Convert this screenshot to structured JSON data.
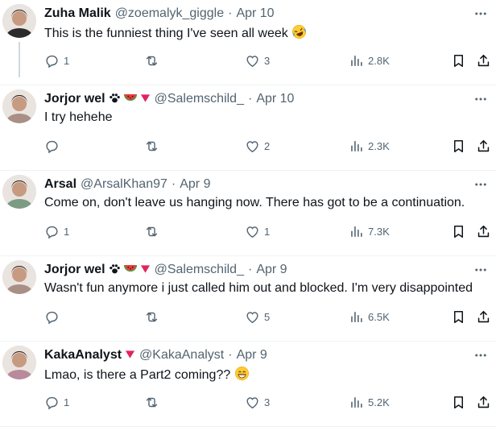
{
  "replies": [
    {
      "name": "Zuha Malik",
      "handle": "@zoemalyk_giggle",
      "dot": "·",
      "date": "Apr 10",
      "text": "This is the funniest thing I've seen all week",
      "emoji": "rofl",
      "badges": [],
      "avatar_color": "#2b2b2b",
      "counts": {
        "replies": "1",
        "reposts": "",
        "likes": "3",
        "views": "2.8K"
      }
    },
    {
      "name": "Jorjor wel",
      "handle": "@Salemschild_",
      "dot": "·",
      "date": "Apr 10",
      "text": "I try hehehe",
      "emoji": "",
      "badges": [
        "paw-icon",
        "watermelon-icon",
        "red-triangle-icon"
      ],
      "avatar_color": "#a98f86",
      "counts": {
        "replies": "",
        "reposts": "",
        "likes": "2",
        "views": "2.3K"
      }
    },
    {
      "name": "Arsal",
      "handle": "@ArsalKhan97",
      "dot": "·",
      "date": "Apr 9",
      "text": "Come on, don't leave us hanging now. There has got to be a continuation.",
      "emoji": "",
      "badges": [],
      "avatar_color": "#7b9c82",
      "counts": {
        "replies": "1",
        "reposts": "",
        "likes": "1",
        "views": "7.3K"
      }
    },
    {
      "name": "Jorjor wel",
      "handle": "@Salemschild_",
      "dot": "·",
      "date": "Apr 9",
      "text": "Wasn't fun anymore i just called him out and blocked. I'm very disappointed",
      "emoji": "",
      "badges": [
        "paw-icon",
        "watermelon-icon",
        "red-triangle-icon"
      ],
      "avatar_color": "#a98f86",
      "counts": {
        "replies": "",
        "reposts": "",
        "likes": "5",
        "views": "6.5K"
      }
    },
    {
      "name": "KakaAnalyst",
      "handle": "@KakaAnalyst",
      "dot": "·",
      "date": "Apr 9",
      "text": "Lmao, is there a Part2 coming??",
      "emoji": "grin",
      "badges": [
        "red-triangle-icon"
      ],
      "avatar_color": "#b88a9b",
      "counts": {
        "replies": "1",
        "reposts": "",
        "likes": "3",
        "views": "5.2K"
      }
    }
  ],
  "colors": {
    "muted": "#536471",
    "text": "#0f1419",
    "divider": "#eff3f4",
    "triangle": "#e0245e"
  }
}
